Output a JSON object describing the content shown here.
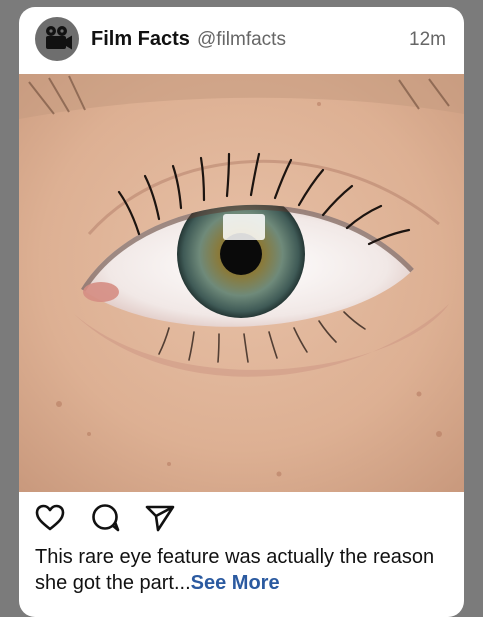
{
  "post": {
    "account_name": "Film Facts",
    "handle": "@filmfacts",
    "time_ago": "12m",
    "avatar_icon": "film-camera-icon",
    "caption_text": "This rare eye feature was actually the reason she got the part...",
    "see_more_label": "See More",
    "image_subject": "close-up human eye with hazel-green iris"
  },
  "actions": {
    "like_icon": "heart-icon",
    "comment_icon": "comment-bubble-icon",
    "share_icon": "send-arrow-icon"
  },
  "colors": {
    "background": "#7b7b7b",
    "card": "#ffffff",
    "link": "#2b5aa0",
    "avatar": "#6e6e6e"
  }
}
